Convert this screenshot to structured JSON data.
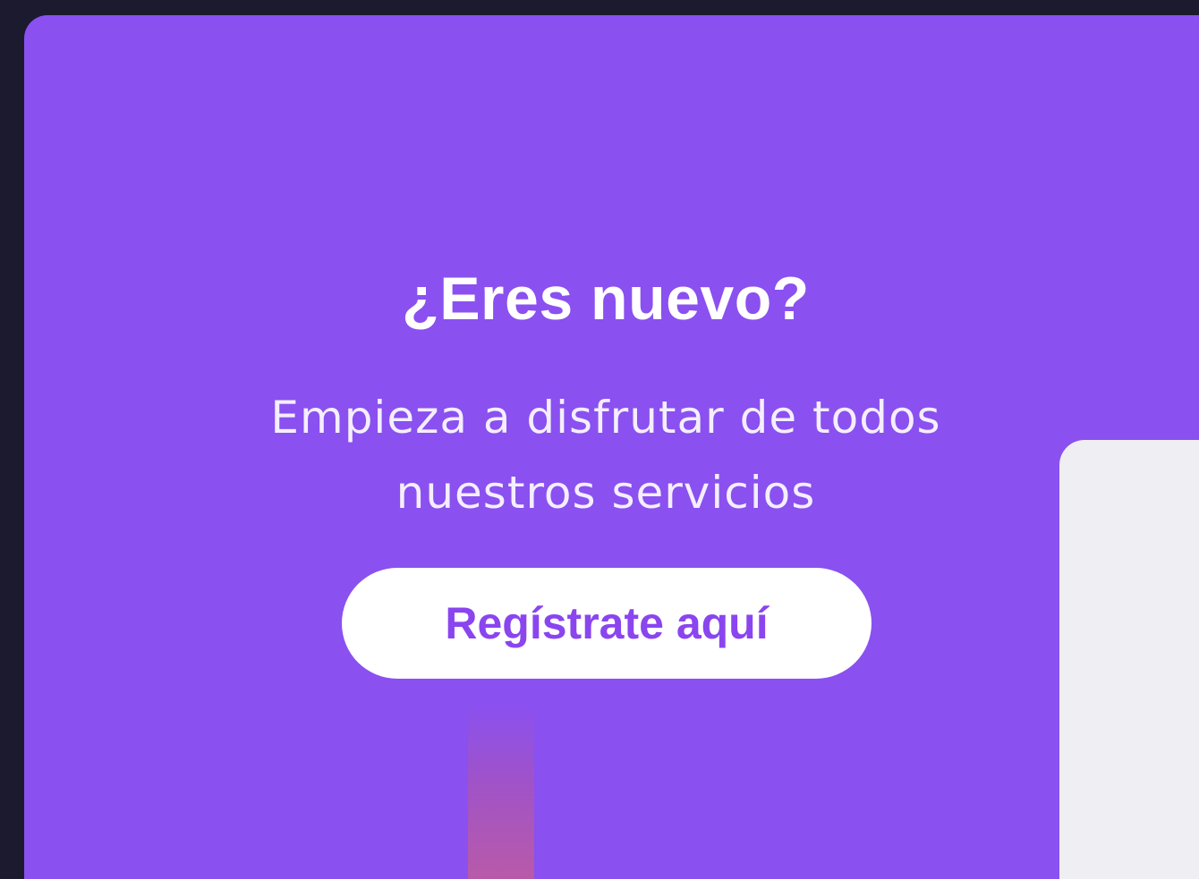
{
  "signup_panel": {
    "title": "¿Eres nuevo?",
    "subtitle_line1": "Empieza a disfrutar de todos",
    "subtitle_line2": "nuestros servicios",
    "cta_label": "Regístrate aquí"
  },
  "colors": {
    "background": "#1c1a2e",
    "panel": "#8a50f0",
    "button_bg": "#ffffff",
    "button_text": "#8a45ef",
    "card": "#efeef3"
  }
}
